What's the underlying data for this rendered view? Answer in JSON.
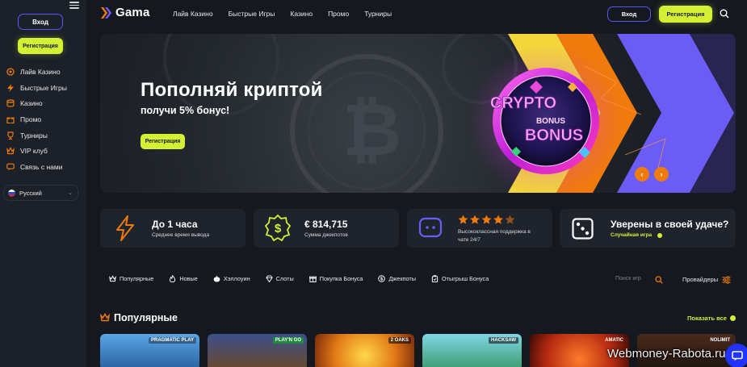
{
  "sidebar": {
    "login_label": "Вход",
    "register_label": "Регистрация",
    "items": [
      {
        "label": "Лайв Казино",
        "icon": "live-casino-icon"
      },
      {
        "label": "Быстрые Игры",
        "icon": "lightning-icon"
      },
      {
        "label": "Казино",
        "icon": "casino-chips-icon"
      },
      {
        "label": "Промо",
        "icon": "gift-icon"
      },
      {
        "label": "Турниры",
        "icon": "trophy-icon"
      },
      {
        "label": "VIP клуб",
        "icon": "vip-crown-icon"
      },
      {
        "label": "Связь с нами",
        "icon": "chat-icon"
      }
    ],
    "language": "Русский"
  },
  "header": {
    "logo": "Gama",
    "nav": [
      "Лайв Казино",
      "Быстрые Игры",
      "Казино",
      "Промо",
      "Турниры"
    ],
    "login_label": "Вход",
    "register_label": "Регистрация"
  },
  "hero": {
    "title": "Пополняй криптой",
    "subtitle": "получи 5% бонус!",
    "button_label": "Регистрация",
    "art_line1": "CRYPTO",
    "art_line2": "BONUS",
    "art_line3": "BONUS",
    "prev": "‹",
    "next": "›"
  },
  "cards": [
    {
      "title": "До 1 часа",
      "subtitle": "Среднее время вывода",
      "icon": "lightning-icon"
    },
    {
      "title": "€ 814,715",
      "subtitle": "Сумма джекпотов",
      "icon": "dollar-badge-icon"
    },
    {
      "title": "",
      "subtitle_line1": "Высококлассная поддержка в",
      "subtitle_line2": "чате 24/7",
      "rating_stars": 4.5,
      "icon": "support-chat-icon"
    },
    {
      "title": "Уверены в своей удаче?",
      "subtitle": "Случайная игра",
      "icon": "dice-icon"
    }
  ],
  "filters": [
    {
      "label": "Популярные",
      "icon": "crown-icon"
    },
    {
      "label": "Новые",
      "icon": "flame-icon"
    },
    {
      "label": "Хэллоуин",
      "icon": "pumpkin-icon"
    },
    {
      "label": "Слоты",
      "icon": "diamond-icon"
    },
    {
      "label": "Покупка Бонуса",
      "icon": "bonus-buy-icon"
    },
    {
      "label": "Джекпоты",
      "icon": "jackpot-coin-icon"
    },
    {
      "label": "Отыгрыш Бонуса",
      "icon": "wager-icon"
    }
  ],
  "search_placeholder": "Поиск игр",
  "providers_label": "Провайдеры",
  "popular": {
    "title": "Популярные",
    "show_all": "Показать все",
    "tiles": [
      {
        "brand": "PRAGMATIC PLAY",
        "color": "#2a6fb8"
      },
      {
        "brand": "PLAY'N GO",
        "color": "#2b3f7a"
      },
      {
        "brand": "2 OAKS",
        "color": "#e27a16"
      },
      {
        "brand": "HACKSAW",
        "color": "#3aa7c2"
      },
      {
        "brand": "AMATIC",
        "color": "#c0421a"
      },
      {
        "brand": "NOLIMIT",
        "color": "#5b2a1c"
      }
    ]
  },
  "watermark": "Webmoney-Rabota.ru",
  "colors": {
    "accent_lime": "#d4f034",
    "accent_purple": "#5a55f0",
    "accent_orange": "#f07a0c",
    "bg": "#15191f"
  }
}
